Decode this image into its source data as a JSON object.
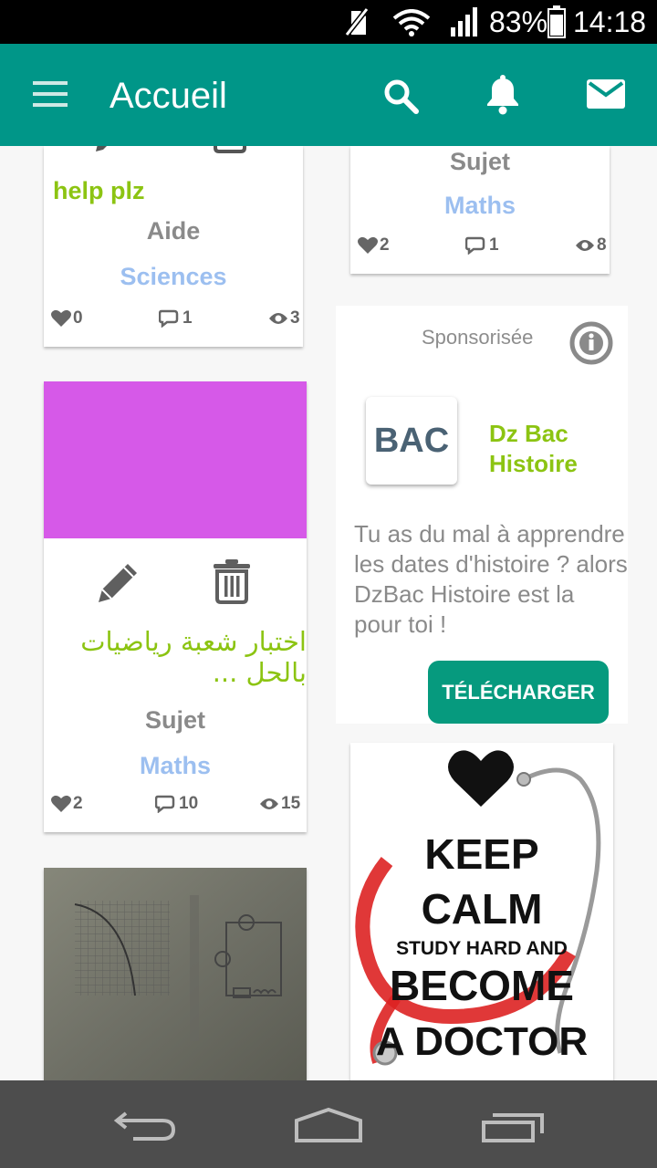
{
  "status_bar": {
    "battery": "83%",
    "time": "14:18"
  },
  "app_bar": {
    "title": "Accueil"
  },
  "cards": {
    "card1": {
      "title": "help plz",
      "category": "Aide",
      "subject": "Sciences",
      "likes": "0",
      "comments": "1",
      "views": "3"
    },
    "card2": {
      "category": "Sujet",
      "subject": "Maths",
      "likes": "2",
      "comments": "1",
      "views": "8"
    },
    "card3": {
      "title": "اختبار شعبة رياضيات بالحل ...",
      "category": "Sujet",
      "subject": "Maths",
      "likes": "2",
      "comments": "10",
      "views": "15",
      "image_color": "#d659e8"
    }
  },
  "ad": {
    "label": "Sponsorisée",
    "logo_text": "BAC",
    "app_name": "Dz Bac Histoire",
    "description": "Tu as du mal à apprendre les dates d'histoire ? alors DzBac Histoire est la pour toi !",
    "cta": "TÉLÉCHARGER"
  },
  "poster": {
    "line1": "KEEP",
    "line2": "CALM",
    "line3": "STUDY HARD AND",
    "line4": "BECOME",
    "line5": "A DOCTOR"
  },
  "colors": {
    "primary": "#009688",
    "accent_green": "#8cc412",
    "subject_blue": "#9cbff0",
    "cta": "#069a7e"
  }
}
